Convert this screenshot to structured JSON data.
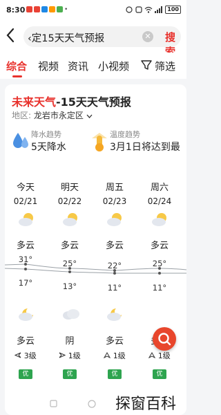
{
  "status_bar": {
    "time": "8:30",
    "battery": "100"
  },
  "search": {
    "back_label": "‹",
    "query": "‹定15天天气预报",
    "submit_label": "搜索"
  },
  "tabs": [
    {
      "label": "综合",
      "active": true
    },
    {
      "label": "视频"
    },
    {
      "label": "资讯"
    },
    {
      "label": "小视频"
    },
    {
      "label": "筛选"
    }
  ],
  "card": {
    "title_prefix": "未来天气",
    "title_rest": "-15天天气预报",
    "region_label": "地区:",
    "region_value": "龙岩市永定区",
    "rain_trend": {
      "label": "降水趋势",
      "value": "5天降水"
    },
    "temp_trend": {
      "label": "温度趋势",
      "value": "3月1日将达到最"
    }
  },
  "days": [
    {
      "day": "今天",
      "date": "02/21",
      "cond_day": "多云",
      "high": "31°",
      "low": "17°",
      "cond_night": "多云",
      "wind": "3级",
      "aqi": "优"
    },
    {
      "day": "明天",
      "date": "02/22",
      "cond_day": "多云",
      "high": "25°",
      "low": "13°",
      "cond_night": "阴",
      "wind": "1级",
      "aqi": "优"
    },
    {
      "day": "周五",
      "date": "02/23",
      "cond_day": "多云",
      "high": "22°",
      "low": "11°",
      "cond_night": "多云",
      "wind": "1级",
      "aqi": "优"
    },
    {
      "day": "周六",
      "date": "02/24",
      "cond_day": "多云",
      "high": "25°",
      "low": "11°",
      "cond_night": "多云",
      "wind": "1级",
      "aqi": "优"
    }
  ],
  "colors": {
    "accent": "#e8312c",
    "aqi_good": "#2ea44f"
  },
  "watermark": "探窗百科"
}
